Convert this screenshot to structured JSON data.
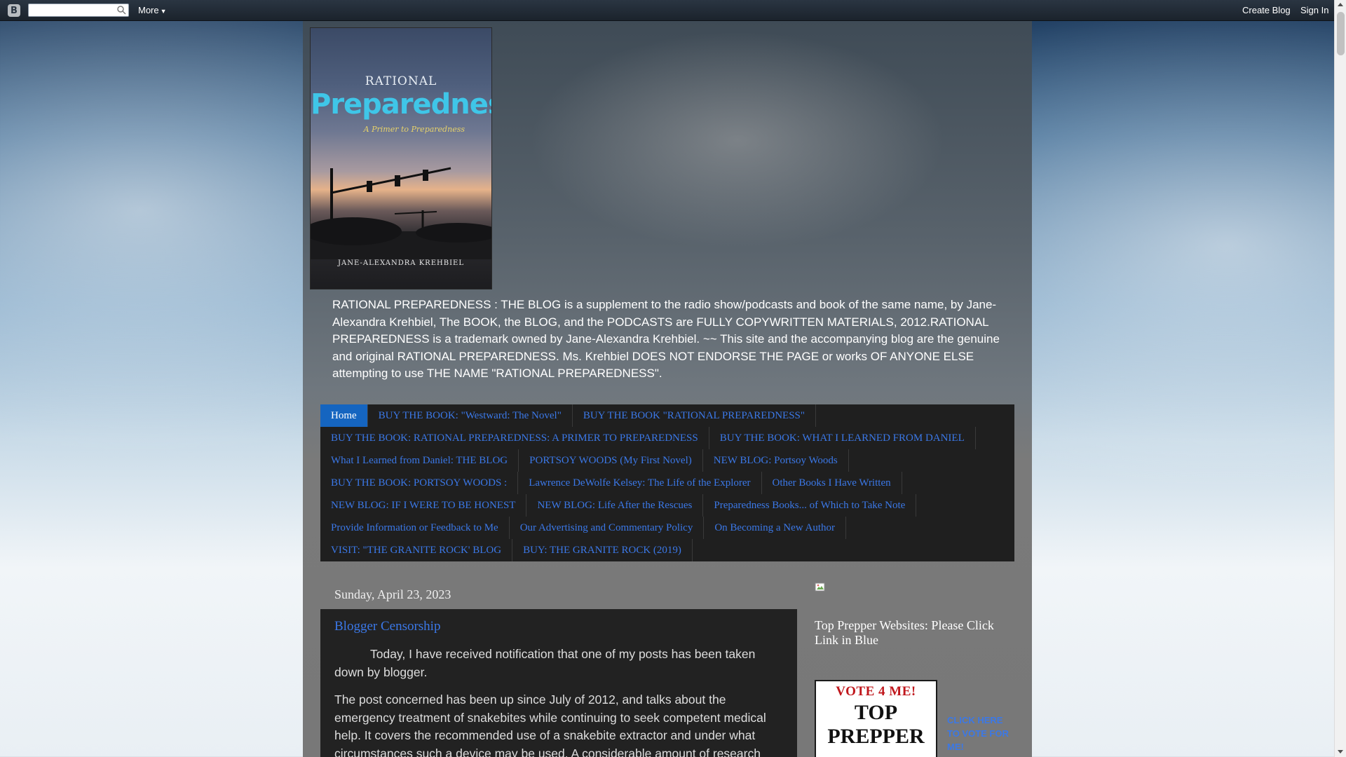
{
  "navbar": {
    "search_placeholder": "",
    "more_label": "More",
    "create_blog_label": "Create Blog",
    "sign_in_label": "Sign In"
  },
  "header": {
    "cover": {
      "top_word": "RATIONAL",
      "main_word": "Preparedness",
      "subtitle": "A Primer to Preparedness",
      "author": "JANE-ALEXANDRA KREHBIEL"
    },
    "description": "RATIONAL PREPAREDNESS : THE BLOG is a supplement to the radio show/podcasts and book of the same name, by Jane-Alexandra Krehbiel, The BOOK, the BLOG, and the PODCASTS are FULLY COPYWRITTEN MATERIALS, 2012.RATIONAL PREPAREDNESS is a trademark owned by Jane-Alexandra Krehbiel. ~~ This site and the accompanying blog are the genuine and original RATIONAL PREPAREDNESS. Ms. Krehbiel DOES NOT ENDORSE THE PAGE or works OF ANYONE ELSE attempting to use THE NAME \"RATIONAL PREPAREDNESS\"."
  },
  "tabs": [
    {
      "label": "Home",
      "active": true
    },
    {
      "label": "BUY THE BOOK: \"Westward: The Novel\""
    },
    {
      "label": "BUY THE BOOK \"RATIONAL PREPAREDNESS\""
    },
    {
      "label": "BUY THE BOOK: RATIONAL PREPAREDNESS: A PRIMER TO PREPAREDNESS"
    },
    {
      "label": "BUY THE BOOK: WHAT I LEARNED FROM DANIEL"
    },
    {
      "label": "What I Learned from Daniel: THE BLOG"
    },
    {
      "label": "PORTSOY WOODS (My First Novel)"
    },
    {
      "label": "NEW BLOG: Portsoy Woods"
    },
    {
      "label": "BUY THE BOOK: PORTSOY WOODS :"
    },
    {
      "label": "Lawrence DeWolfe Kelsey: The Life of the Explorer"
    },
    {
      "label": "Other Books I Have Written"
    },
    {
      "label": "NEW BLOG: IF I WERE TO BE HONEST"
    },
    {
      "label": "NEW BLOG: Life After the Rescues"
    },
    {
      "label": "Preparedness Books... of Which to Take Note"
    },
    {
      "label": "Provide Information or Feedback to Me"
    },
    {
      "label": "Our Advertising and Commentary Policy"
    },
    {
      "label": "On Becoming a New Author"
    },
    {
      "label": "VISIT: \"THE GRANITE ROCK' BLOG"
    },
    {
      "label": "BUY: THE GRANITE ROCK (2019)"
    }
  ],
  "post": {
    "date": "Sunday, April 23, 2023",
    "title": "Blogger Censorship",
    "paragraphs": [
      "Today, I have received notification that one of my posts has been taken down by blogger.",
      "The post concerned has been up since July of 2012, and talks about the emergency treatment of snakebites while continuing to seek competent medical help. It covers the recommended use of a snakebite extractor and under what circumstances such a device may be used. A considerable amount of research"
    ]
  },
  "sidebar": {
    "widget_title": "Top Prepper Websites: Please Click Link in Blue",
    "badge": {
      "line1": "VOTE 4 ME!",
      "line2": "TOP",
      "line3": "PREPPER"
    },
    "vote_link": "CLICK HERE TO VOTE FOR ME!"
  },
  "colors": {
    "link": "#3b78e7",
    "active_tab": "#1565c0",
    "tab_bar": "#1f1f1f",
    "post_bg": "#222222",
    "badge_red": "#c0171c"
  }
}
